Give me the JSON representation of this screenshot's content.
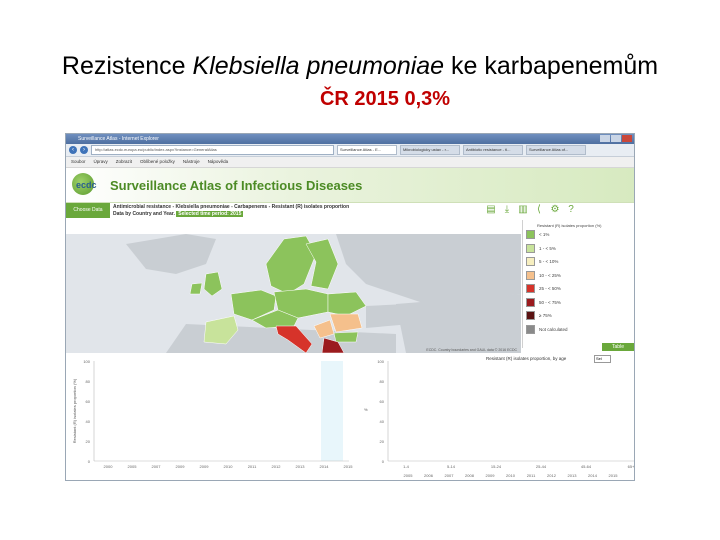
{
  "slide": {
    "title_pre": "Rezistence ",
    "title_italic": "Klebsiella pneumoniae",
    "title_post": " ke karbapenemům",
    "subtitle": "ČR 2015 0,3%"
  },
  "browser": {
    "window_title": "Surveillance Atlas - Internet Explorer",
    "url": "http://atlas.ecdc.europa.eu/public/index.aspx?Instance=GeneralAtlas",
    "tabs": [
      "Surveillance Atlas - E...",
      "Mikrobiologicky ustav - r...",
      "Antibiotic resistance - tl...",
      "Surveillance Atlas of..."
    ],
    "menu": [
      "Soubor",
      "Úpravy",
      "Zobrazit",
      "Oblíbené položky",
      "Nástroje",
      "Nápověda"
    ]
  },
  "app": {
    "logo_text": "ecdc",
    "title": "Surveillance Atlas of Infectious Diseases",
    "choose_btn": "Choose Data",
    "info_line1": "Antimicrobial resistance - Klebsiella pneumoniae - Carbapenems - Resistant (R) isolates proportion",
    "info_line2_pre": "Data by Country and Year.",
    "period": "Selected time period: 2015",
    "map_credit": "ECDC. Country boundaries and GAUL data © 2016 ECDC"
  },
  "legend": {
    "title": "Resistant (R) isolates proportion (%)",
    "items": [
      {
        "label": "< 1%",
        "color": "#8cc35c"
      },
      {
        "label": "1 - < 5%",
        "color": "#c8e39b"
      },
      {
        "label": "5 - < 10%",
        "color": "#f7efc0"
      },
      {
        "label": "10 - < 25%",
        "color": "#f5c08c"
      },
      {
        "label": "25 - < 50%",
        "color": "#d6332a"
      },
      {
        "label": "50 - < 75%",
        "color": "#9b1b1e"
      },
      {
        "label": "≥ 75%",
        "color": "#5a1212"
      },
      {
        "label": "Not calculated",
        "color": "#8a8a8a"
      }
    ],
    "table_btn": "Table"
  },
  "colors": {
    "brand_green": "#6aa83b"
  },
  "charts": {
    "left_ylabel": "Resistant (R) isolates proportion (%)",
    "left_y_ticks": [
      "100",
      "80",
      "60",
      "40",
      "20",
      "0"
    ],
    "left_x_ticks": [
      "2000",
      "2005",
      "2007",
      "2009",
      "2009",
      "2010",
      "2011",
      "2012",
      "2013",
      "2014",
      "2015"
    ],
    "age_label": "Resistant (R) isolates proportion, by age",
    "age_select": "Sel",
    "right_ylabel": "%",
    "right_y_ticks": [
      "100",
      "80",
      "60",
      "40",
      "20",
      "0"
    ],
    "right_x_ticks": [
      "1-4",
      "5-14",
      "15-24",
      "25-44",
      "45-64",
      "65+"
    ],
    "timeline_years": [
      "2005",
      "2006",
      "2007",
      "2008",
      "2009",
      "2010",
      "2011",
      "2012",
      "2013",
      "2014",
      "2015"
    ]
  }
}
